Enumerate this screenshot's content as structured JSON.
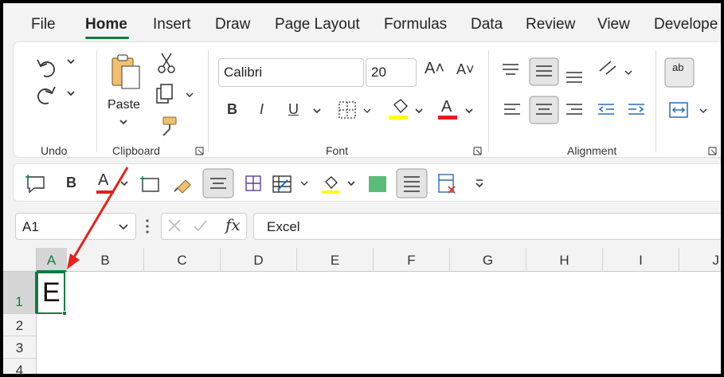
{
  "tabs": [
    {
      "label": "File",
      "active": false
    },
    {
      "label": "Home",
      "active": true
    },
    {
      "label": "Insert",
      "active": false
    },
    {
      "label": "Draw",
      "active": false
    },
    {
      "label": "Page Layout",
      "active": false
    },
    {
      "label": "Formulas",
      "active": false
    },
    {
      "label": "Data",
      "active": false
    },
    {
      "label": "Review",
      "active": false
    },
    {
      "label": "View",
      "active": false
    },
    {
      "label": "Develope",
      "active": false
    }
  ],
  "ribbon": {
    "groups": {
      "undo": "Undo",
      "clipboard": "Clipboard",
      "font": "Font",
      "alignment": "Alignment"
    },
    "paste_label": "Paste",
    "font_name": "Calibri",
    "font_size": "20",
    "bold": "B",
    "italic": "I",
    "underline": "U",
    "font_color_glyph": "A",
    "grow_font": "A˄",
    "shrink_font": "A˅",
    "wrap_glyph": "ab"
  },
  "mini_toolbar": {
    "bold": "B",
    "font_color_glyph": "A"
  },
  "formula_bar": {
    "name_box": "A1",
    "fx": "fx",
    "content": "Excel"
  },
  "grid": {
    "columns": [
      "A",
      "B",
      "C",
      "D",
      "E",
      "F",
      "G",
      "H",
      "I",
      "J"
    ],
    "rows": [
      "1",
      "2",
      "3",
      "4"
    ],
    "active_cell_value": "E"
  },
  "colors": {
    "accent": "#107c41",
    "highlight": "#ffff00",
    "font_color": "#e02020",
    "arrow": "#e8211a"
  }
}
